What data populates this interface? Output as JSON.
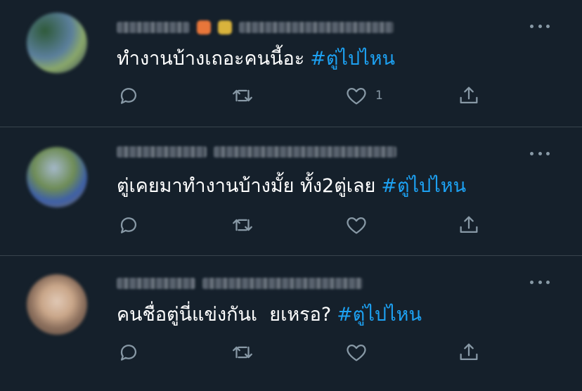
{
  "tweets": [
    {
      "text": "ทำงานบ้างเถอะคนนี้อะ",
      "hashtag": "#ตู่ไปไหน",
      "actions": {
        "reply": "",
        "retweet": "",
        "like": "1",
        "share": ""
      },
      "avatar_colors": [
        "#2f5a3a",
        "#5b7f9c",
        "#8aa86a",
        "#2d3d55"
      ]
    },
    {
      "text": "ตู่เคยมาทำงานบ้างมั้ย ทั้ง2ตู่เลย",
      "hashtag": "#ตู่ไปไหน",
      "actions": {
        "reply": "",
        "retweet": "",
        "like": "",
        "share": ""
      },
      "avatar_colors": [
        "#6e8c56",
        "#a4b8c9",
        "#3d5fa8",
        "#88734f"
      ]
    },
    {
      "text": "คนชื่อตู่นี่แข่งกันเ  ยเหรอ?",
      "hashtag": "#ตู่ไปไหน",
      "actions": {
        "reply": "",
        "retweet": "",
        "like": "",
        "share": ""
      },
      "avatar_colors": [
        "#c9a689",
        "#8a6e5c",
        "#e0c8b5",
        "#5a4a40"
      ]
    }
  ],
  "colors": {
    "background": "#15202b",
    "divider": "#38444d",
    "text": "#ffffff",
    "secondary": "#8899a6",
    "hashtag": "#1da1f2"
  },
  "icons": [
    "reply-icon",
    "retweet-icon",
    "like-icon",
    "share-icon",
    "more-icon"
  ]
}
